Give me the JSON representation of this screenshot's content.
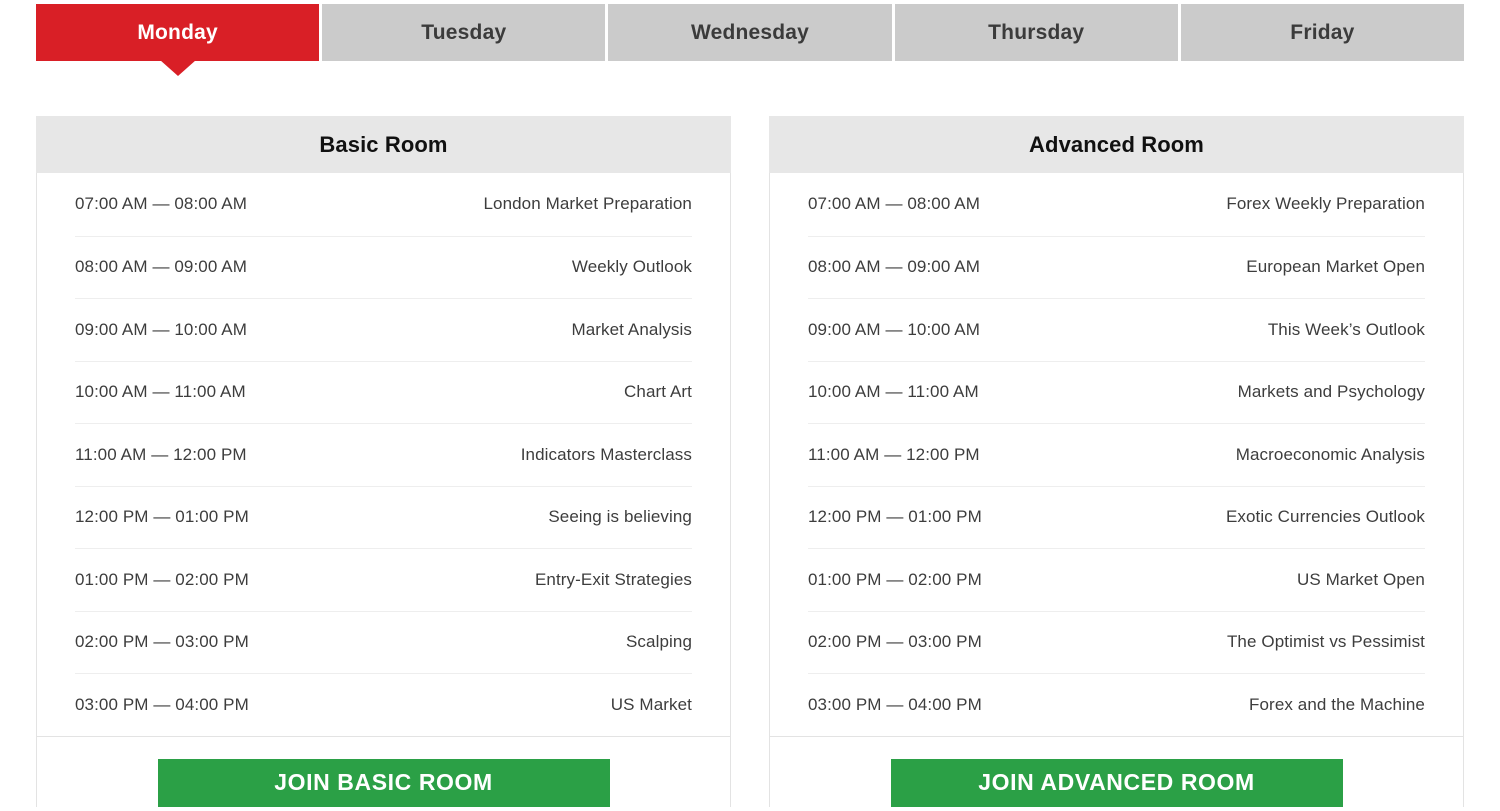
{
  "tabs": {
    "active_index": 0,
    "active_color": "#d91f26",
    "inactive_color": "#cbcbcb",
    "items": [
      {
        "label": "Monday"
      },
      {
        "label": "Tuesday"
      },
      {
        "label": "Wednesday"
      },
      {
        "label": "Thursday"
      },
      {
        "label": "Friday"
      }
    ]
  },
  "rooms": [
    {
      "title": "Basic Room",
      "join_label": "JOIN BASIC ROOM",
      "join_color": "#2ba046",
      "schedule": [
        {
          "time": "07:00 AM — 08:00 AM",
          "session": "London Market Preparation"
        },
        {
          "time": "08:00 AM — 09:00 AM",
          "session": "Weekly Outlook"
        },
        {
          "time": "09:00 AM — 10:00 AM",
          "session": "Market Analysis"
        },
        {
          "time": "10:00 AM — 11:00 AM",
          "session": "Chart Art"
        },
        {
          "time": "11:00 AM — 12:00 PM",
          "session": "Indicators Masterclass"
        },
        {
          "time": "12:00 PM — 01:00 PM",
          "session": "Seeing is believing"
        },
        {
          "time": "01:00 PM — 02:00 PM",
          "session": "Entry-Exit Strategies"
        },
        {
          "time": "02:00 PM — 03:00 PM",
          "session": "Scalping"
        },
        {
          "time": "03:00 PM — 04:00 PM",
          "session": "US Market"
        }
      ]
    },
    {
      "title": "Advanced Room",
      "join_label": "JOIN ADVANCED ROOM",
      "join_color": "#2ba046",
      "schedule": [
        {
          "time": "07:00 AM — 08:00 AM",
          "session": "Forex Weekly Preparation"
        },
        {
          "time": "08:00 AM — 09:00 AM",
          "session": "European Market Open"
        },
        {
          "time": "09:00 AM — 10:00 AM",
          "session": "This Week’s Outlook"
        },
        {
          "time": "10:00 AM — 11:00 AM",
          "session": "Markets and Psychology"
        },
        {
          "time": "11:00 AM — 12:00 PM",
          "session": "Macroeconomic Analysis"
        },
        {
          "time": "12:00 PM — 01:00 PM",
          "session": "Exotic Currencies Outlook"
        },
        {
          "time": "01:00 PM — 02:00 PM",
          "session": "US Market Open"
        },
        {
          "time": "02:00 PM — 03:00 PM",
          "session": "The Optimist vs Pessimist"
        },
        {
          "time": "03:00 PM — 04:00 PM",
          "session": "Forex and the Machine"
        }
      ]
    }
  ]
}
